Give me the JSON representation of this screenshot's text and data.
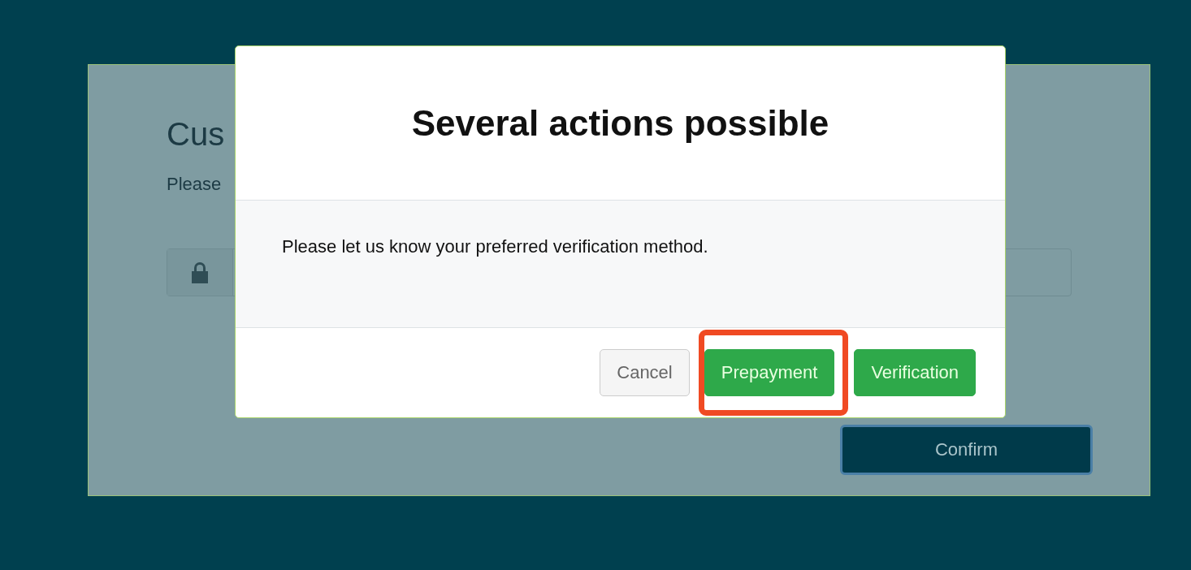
{
  "background_page": {
    "heading": "Cus",
    "text": "Please",
    "confirm_button": "Confirm"
  },
  "dialog": {
    "title": "Several actions possible",
    "message": "Please let us know your preferred verification method.",
    "buttons": [
      {
        "label": "Cancel",
        "kind": "default",
        "highlighted": false
      },
      {
        "label": "Prepayment",
        "kind": "success",
        "highlighted": true
      },
      {
        "label": "Verification",
        "kind": "success",
        "highlighted": false
      }
    ]
  }
}
